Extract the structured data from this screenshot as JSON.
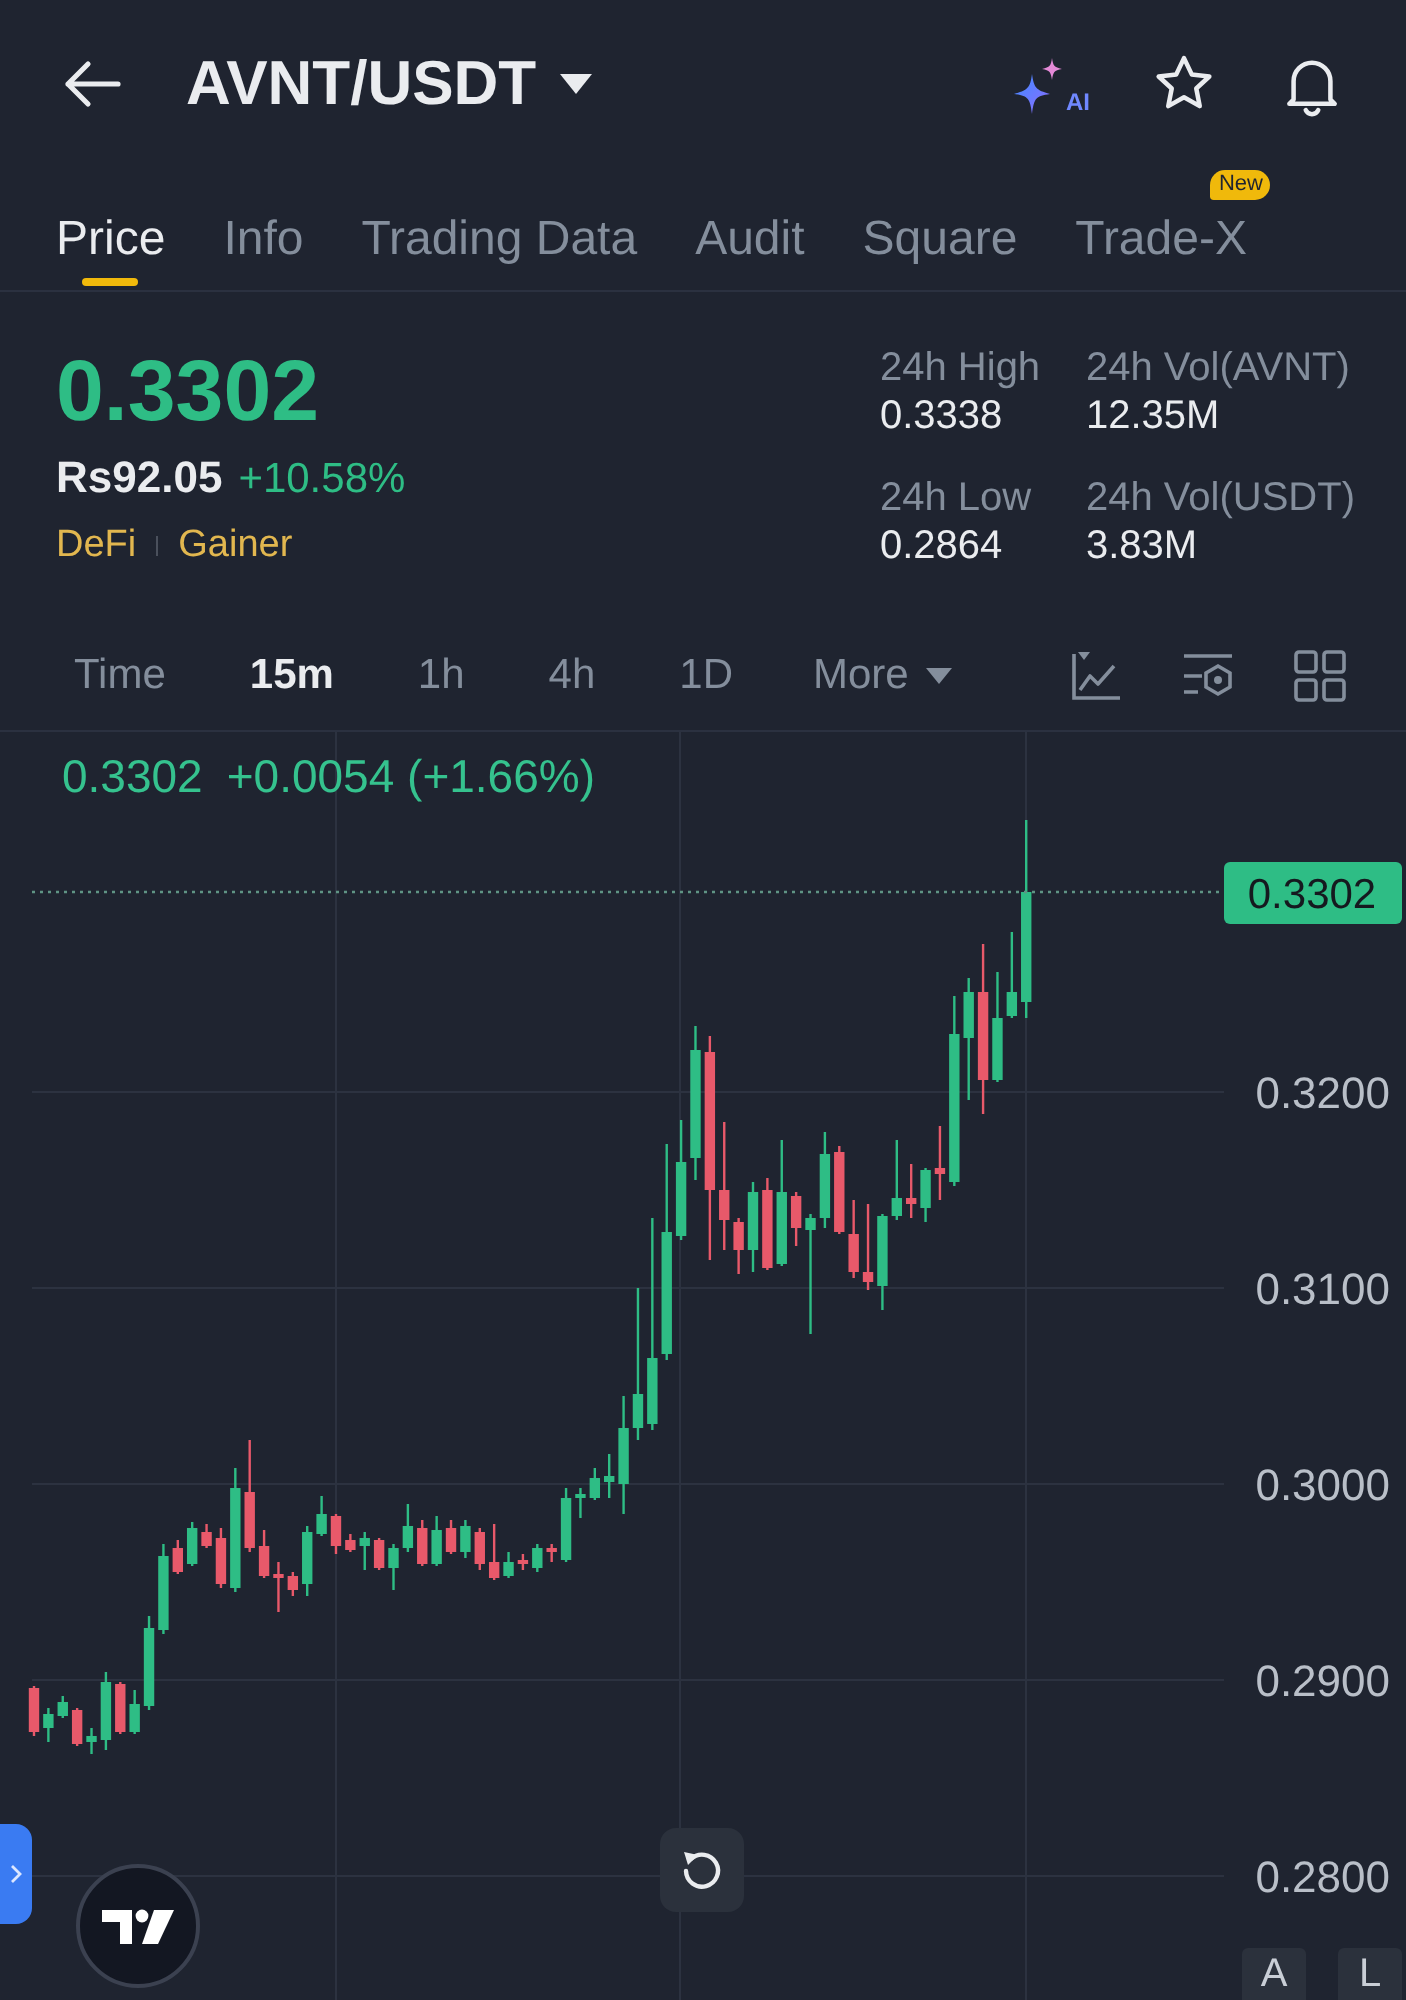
{
  "header": {
    "title": "AVNT/USDT",
    "ai_label": "AI"
  },
  "tabs": [
    {
      "label": "Price",
      "selected": true
    },
    {
      "label": "Info",
      "selected": false
    },
    {
      "label": "Trading Data",
      "selected": false
    },
    {
      "label": "Audit",
      "selected": false
    },
    {
      "label": "Square",
      "selected": false
    },
    {
      "label": "Trade-X",
      "selected": false,
      "badge": "New"
    }
  ],
  "ticker": {
    "price": "0.3302",
    "fiat_price": "Rs92.05",
    "change": "+10.58%",
    "tags": [
      "DeFi",
      "Gainer"
    ]
  },
  "stats": [
    {
      "label": "24h High",
      "value": "0.3338"
    },
    {
      "label": "24h Vol(AVNT)",
      "value": "12.35M"
    },
    {
      "label": "24h Low",
      "value": "0.2864"
    },
    {
      "label": "24h Vol(USDT)",
      "value": "3.83M"
    }
  ],
  "intervals": [
    {
      "label": "Time",
      "selected": false
    },
    {
      "label": "15m",
      "selected": true
    },
    {
      "label": "1h",
      "selected": false
    },
    {
      "label": "4h",
      "selected": false
    },
    {
      "label": "1D",
      "selected": false
    }
  ],
  "more_menu": {
    "label": "More"
  },
  "chart": {
    "last_price": "0.3302",
    "change": "+0.0054 (+1.66%)",
    "price_tag": "0.3302",
    "y_axis_labels": [
      "0.3200",
      "0.3100",
      "0.3000",
      "0.2900",
      "0.2800"
    ],
    "scale_buttons": [
      "A",
      "L"
    ]
  }
}
